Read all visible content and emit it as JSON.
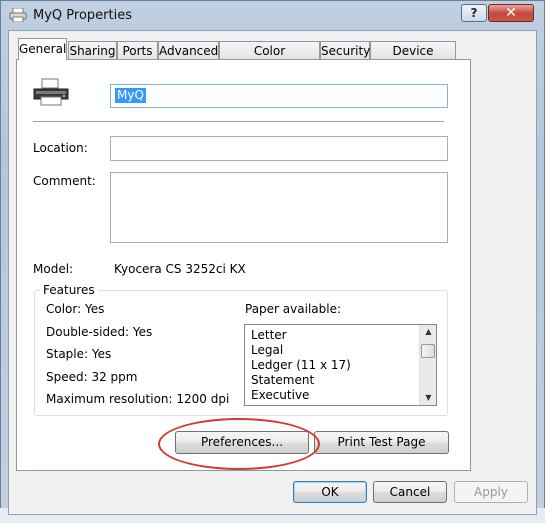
{
  "window": {
    "title": "MyQ Properties",
    "help_label": "?",
    "close_label": "✕",
    "title_icon": "printer-icon"
  },
  "tabs": [
    "General",
    "Sharing",
    "Ports",
    "Advanced",
    "Color Management",
    "Security",
    "Device Settings"
  ],
  "general": {
    "printer_icon": "printer-icon",
    "name_value": "MyQ",
    "location_label": "Location:",
    "location_value": "",
    "comment_label": "Comment:",
    "comment_value": "",
    "model_label": "Model:",
    "model_value": "Kyocera CS 3252ci KX"
  },
  "features": {
    "title": "Features",
    "color": "Color: Yes",
    "double_sided": "Double-sided: Yes",
    "staple": "Staple: Yes",
    "speed": "Speed: 32 ppm",
    "max_resolution": "Maximum resolution: 1200 dpi",
    "paper_label": "Paper available:",
    "paper_items": [
      "Letter",
      "Legal",
      "Ledger (11 x 17)",
      "Statement",
      "Executive"
    ]
  },
  "buttons": {
    "preferences": "Preferences...",
    "print_test_page": "Print Test Page",
    "ok": "OK",
    "cancel": "Cancel",
    "apply": "Apply"
  },
  "colors": {
    "selection": "#3399ff",
    "highlight_ellipse": "#d43a32"
  }
}
